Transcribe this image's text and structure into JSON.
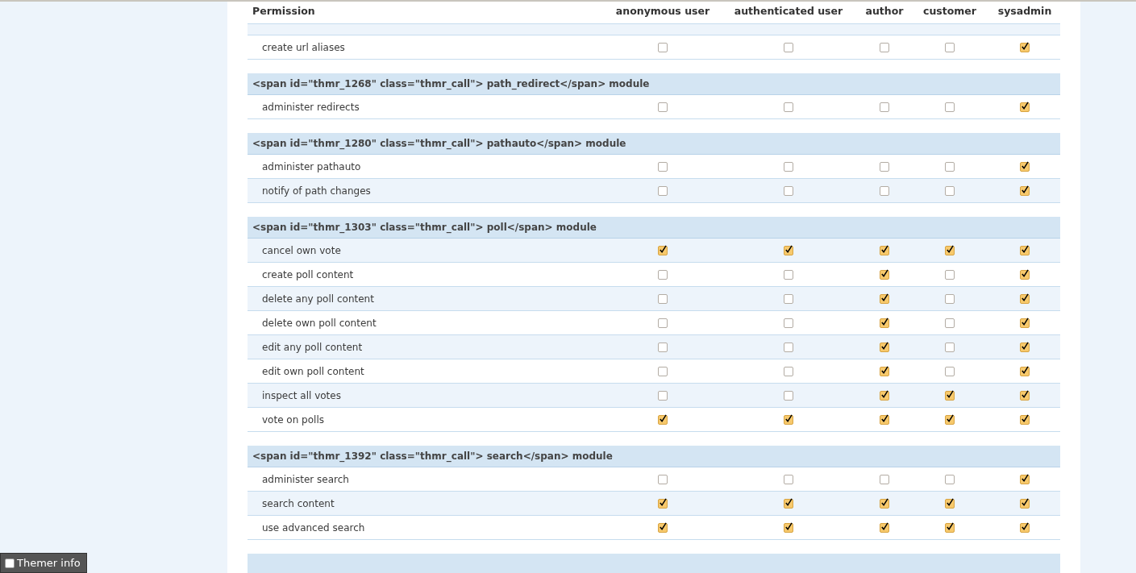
{
  "table": {
    "columns": [
      "Permission",
      "anonymous user",
      "authenticated user",
      "author",
      "customer",
      "sysadmin"
    ],
    "groups": [
      {
        "rows": [
          {
            "label": "create url aliases",
            "checks": [
              false,
              false,
              false,
              false,
              true
            ]
          }
        ]
      },
      {
        "module": "<span id=\"thmr_1268\" class=\"thmr_call\"> path_redirect</span> module",
        "rows": [
          {
            "label": "administer redirects",
            "checks": [
              false,
              false,
              false,
              false,
              true
            ]
          }
        ]
      },
      {
        "module": "<span id=\"thmr_1280\" class=\"thmr_call\"> pathauto</span> module",
        "rows": [
          {
            "label": "administer pathauto",
            "checks": [
              false,
              false,
              false,
              false,
              true
            ]
          },
          {
            "label": "notify of path changes",
            "checks": [
              false,
              false,
              false,
              false,
              true
            ]
          }
        ]
      },
      {
        "module": "<span id=\"thmr_1303\" class=\"thmr_call\"> poll</span> module",
        "rows": [
          {
            "label": "cancel own vote",
            "checks": [
              true,
              true,
              true,
              true,
              true
            ]
          },
          {
            "label": "create poll content",
            "checks": [
              false,
              false,
              true,
              false,
              true
            ]
          },
          {
            "label": "delete any poll content",
            "checks": [
              false,
              false,
              true,
              false,
              true
            ]
          },
          {
            "label": "delete own poll content",
            "checks": [
              false,
              false,
              true,
              false,
              true
            ]
          },
          {
            "label": "edit any poll content",
            "checks": [
              false,
              false,
              true,
              false,
              true
            ]
          },
          {
            "label": "edit own poll content",
            "checks": [
              false,
              false,
              true,
              false,
              true
            ]
          },
          {
            "label": "inspect all votes",
            "checks": [
              false,
              false,
              true,
              true,
              true
            ]
          },
          {
            "label": "vote on polls",
            "checks": [
              true,
              true,
              true,
              true,
              true
            ]
          }
        ]
      },
      {
        "module": "<span id=\"thmr_1392\" class=\"thmr_call\"> search</span> module",
        "rows": [
          {
            "label": "administer search",
            "checks": [
              false,
              false,
              false,
              false,
              true
            ]
          },
          {
            "label": "search content",
            "checks": [
              true,
              true,
              true,
              true,
              true
            ]
          },
          {
            "label": "use advanced search",
            "checks": [
              true,
              true,
              true,
              true,
              true
            ]
          }
        ]
      }
    ]
  },
  "themer": {
    "label": "Themer info",
    "checked": false
  }
}
